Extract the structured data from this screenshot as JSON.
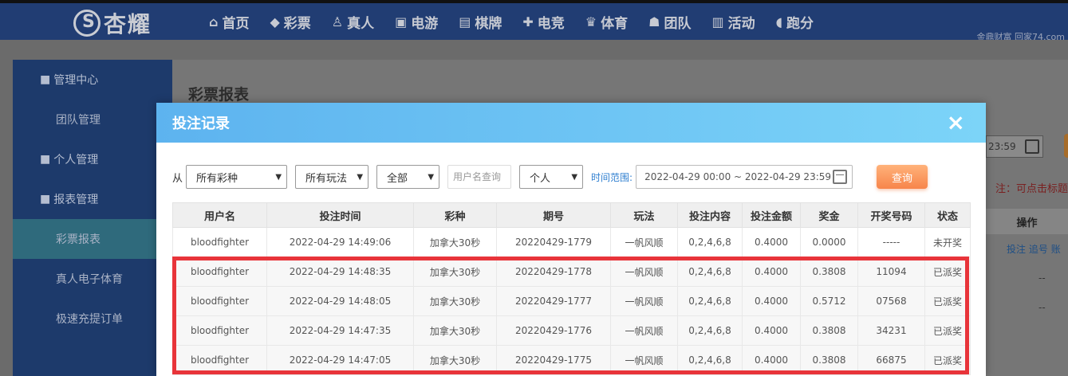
{
  "brand": {
    "name": "杏耀"
  },
  "nav": [
    {
      "icon": "home-icon",
      "glyph": "⌂",
      "label": "首页"
    },
    {
      "icon": "lottery-icon",
      "glyph": "◆",
      "label": "彩票"
    },
    {
      "icon": "live-icon",
      "glyph": "♙",
      "label": "真人"
    },
    {
      "icon": "slot-icon",
      "glyph": "▣",
      "label": "电游"
    },
    {
      "icon": "cards-icon",
      "glyph": "▤",
      "label": "棋牌"
    },
    {
      "icon": "gamepad-icon",
      "glyph": "✚",
      "label": "电竞"
    },
    {
      "icon": "trophy-icon",
      "glyph": "♛",
      "label": "体育"
    },
    {
      "icon": "team-icon",
      "glyph": "☗",
      "label": "团队"
    },
    {
      "icon": "gift-icon",
      "glyph": "▥",
      "label": "活动"
    },
    {
      "icon": "car-icon",
      "glyph": "◖",
      "label": "跑分"
    }
  ],
  "watermark": "金鼎财富 回家74.com",
  "sidebar": {
    "groups": [
      {
        "icon": "users-icon",
        "label": "管理中心",
        "items": [
          "团队管理"
        ]
      },
      {
        "icon": "user-icon",
        "label": "个人管理",
        "items": []
      },
      {
        "icon": "report-icon",
        "label": "报表管理",
        "items": [
          "彩票报表",
          "真人电子体育",
          "极速充提订单"
        ]
      }
    ],
    "active_item": "彩票报表"
  },
  "page": {
    "title": "彩票报表",
    "right_date_tail": "23:59",
    "right_note": "注：可点击标题",
    "ops_header": "操作",
    "ops_links": [
      "投注",
      "追号",
      "账"
    ],
    "dash": "--"
  },
  "modal": {
    "title": "投注记录",
    "close": "×",
    "filters": {
      "from_label": "从",
      "lottery_type": "所有彩种",
      "play_type": "所有玩法",
      "status": "全部",
      "username_placeholder": "用户名查询",
      "scope": "个人",
      "range_label": "时间范围:",
      "range_value": "2022-04-29 00:00 ~ 2022-04-29 23:59",
      "query_button": "查询"
    },
    "table": {
      "columns": [
        "用户名",
        "投注时间",
        "彩种",
        "期号",
        "玩法",
        "投注内容",
        "投注金额",
        "奖金",
        "开奖号码",
        "状态"
      ],
      "rows": [
        {
          "user": "bloodfighter",
          "time": "2022-04-29 14:49:06",
          "lottery": "加拿大30秒",
          "issue": "20220429-1779",
          "play": "一帆风顺",
          "content": "0,2,4,6,8",
          "amount": "0.4000",
          "prize": "0.0000",
          "result": "-----",
          "status": "未开奖",
          "status_kind": "pending"
        },
        {
          "user": "bloodfighter",
          "time": "2022-04-29 14:48:35",
          "lottery": "加拿大30秒",
          "issue": "20220429-1778",
          "play": "一帆风顺",
          "content": "0,2,4,6,8",
          "amount": "0.4000",
          "prize": "0.3808",
          "result": "11094",
          "status": "已派奖",
          "status_kind": "paid"
        },
        {
          "user": "bloodfighter",
          "time": "2022-04-29 14:48:05",
          "lottery": "加拿大30秒",
          "issue": "20220429-1777",
          "play": "一帆风顺",
          "content": "0,2,4,6,8",
          "amount": "0.4000",
          "prize": "0.5712",
          "result": "07568",
          "status": "已派奖",
          "status_kind": "paid"
        },
        {
          "user": "bloodfighter",
          "time": "2022-04-29 14:47:35",
          "lottery": "加拿大30秒",
          "issue": "20220429-1776",
          "play": "一帆风顺",
          "content": "0,2,4,6,8",
          "amount": "0.4000",
          "prize": "0.3808",
          "result": "34231",
          "status": "已派奖",
          "status_kind": "paid"
        },
        {
          "user": "bloodfighter",
          "time": "2022-04-29 14:47:05",
          "lottery": "加拿大30秒",
          "issue": "20220429-1775",
          "play": "一帆风顺",
          "content": "0,2,4,6,8",
          "amount": "0.4000",
          "prize": "0.3808",
          "result": "66875",
          "status": "已派奖",
          "status_kind": "paid"
        }
      ]
    }
  },
  "colors": {
    "accent": "#5db3ef",
    "highlight": "#e8343a",
    "paid": "#e8922b",
    "pending": "#3a9a1a"
  }
}
